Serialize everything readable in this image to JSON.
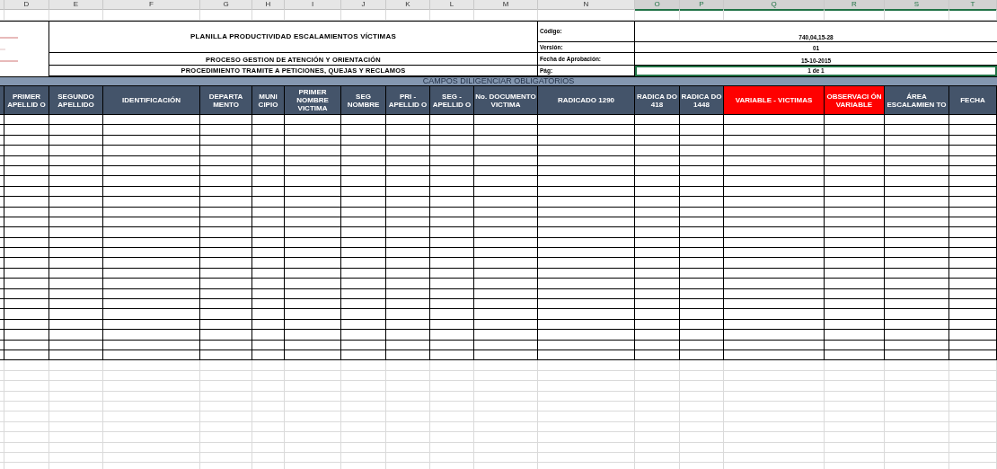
{
  "column_letters": [
    {
      "label": "D",
      "selected": false
    },
    {
      "label": "E",
      "selected": false
    },
    {
      "label": "F",
      "selected": false
    },
    {
      "label": "G",
      "selected": false
    },
    {
      "label": "H",
      "selected": false
    },
    {
      "label": "I",
      "selected": false
    },
    {
      "label": "J",
      "selected": false
    },
    {
      "label": "K",
      "selected": false
    },
    {
      "label": "L",
      "selected": false
    },
    {
      "label": "M",
      "selected": false
    },
    {
      "label": "N",
      "selected": false
    },
    {
      "label": "O",
      "selected": true
    },
    {
      "label": "P",
      "selected": true
    },
    {
      "label": "Q",
      "selected": true
    },
    {
      "label": "R",
      "selected": true
    },
    {
      "label": "S",
      "selected": true
    },
    {
      "label": "T",
      "selected": true
    }
  ],
  "title_block": {
    "titles": [
      "PLANILLA PRODUCTIVIDAD ESCALAMIENTOS VÍCTIMAS",
      "PROCESO GESTION DE ATENCIÓN Y ORIENTACIÓN",
      "PROCEDIMIENTO TRAMITE A PETICIONES, QUEJAS Y RECLAMOS"
    ],
    "fields": [
      {
        "label": "Código:",
        "value": "740,04,15-28",
        "selected": false
      },
      {
        "label": "Versión:",
        "value": "01",
        "selected": false
      },
      {
        "label": "Fecha de Aprobación:",
        "value": "15-10-2015",
        "selected": false
      },
      {
        "label": "Pág:",
        "value": "1 de 1",
        "selected": true
      }
    ]
  },
  "section_banner": "CAMPOS DILIGENCIAR OBLIGATORIOS",
  "headers": [
    {
      "text": "PRIMER APELLID O",
      "color": "#44546a"
    },
    {
      "text": "SEGUNDO APELLIDO",
      "color": "#44546a"
    },
    {
      "text": "IDENTIFICACIÓN",
      "color": "#44546a"
    },
    {
      "text": "DEPARTA MENTO",
      "color": "#44546a"
    },
    {
      "text": "MUNI CIPIO",
      "color": "#44546a"
    },
    {
      "text": "PRIMER NOMBRE VICTIMA",
      "color": "#44546a"
    },
    {
      "text": "SEG NOMBRE",
      "color": "#44546a"
    },
    {
      "text": "PRI - APELLID O",
      "color": "#44546a"
    },
    {
      "text": "SEG - APELLID O",
      "color": "#44546a"
    },
    {
      "text": "No. DOCUMENTO VICTIMA",
      "color": "#44546a"
    },
    {
      "text": "RADICADO 1290",
      "color": "#44546a"
    },
    {
      "text": "RADICA DO 418",
      "color": "#44546a"
    },
    {
      "text": "RADICA DO 1448",
      "color": "#44546a"
    },
    {
      "text": "VARIABLE - VICTIMAS",
      "color": "#ff0000"
    },
    {
      "text": "OBSERVACI ÓN VARIABLE",
      "color": "#ff0000"
    },
    {
      "text": "ÁREA ESCALAMIEN TO",
      "color": "#44546a"
    },
    {
      "text": "FECHA",
      "color": "#44546a"
    }
  ]
}
